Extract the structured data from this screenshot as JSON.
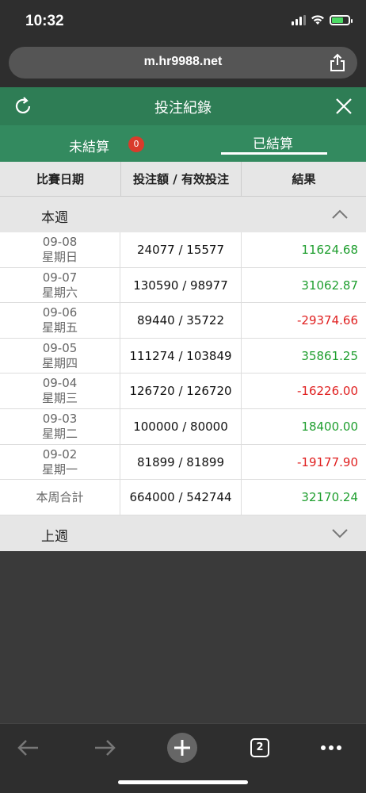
{
  "status_bar": {
    "time": "10:32"
  },
  "browser": {
    "url": "m.hr9988.net",
    "tab_count": "2"
  },
  "header": {
    "title": "投注紀錄"
  },
  "tabs": {
    "unsettled": {
      "label": "未結算",
      "badge": "0"
    },
    "settled": {
      "label": "已結算"
    }
  },
  "table": {
    "columns": [
      "比賽日期",
      "投注額 / 有效投注",
      "結果"
    ]
  },
  "this_week": {
    "title": "本週",
    "rows": [
      {
        "date": "09-08",
        "weekday": "星期日",
        "amount": "24077 / 15577",
        "result": "11624.68",
        "sign": "pos"
      },
      {
        "date": "09-07",
        "weekday": "星期六",
        "amount": "130590 / 98977",
        "result": "31062.87",
        "sign": "pos"
      },
      {
        "date": "09-06",
        "weekday": "星期五",
        "amount": "89440 / 35722",
        "result": "-29374.66",
        "sign": "neg"
      },
      {
        "date": "09-05",
        "weekday": "星期四",
        "amount": "111274 / 103849",
        "result": "35861.25",
        "sign": "pos"
      },
      {
        "date": "09-04",
        "weekday": "星期三",
        "amount": "126720 / 126720",
        "result": "-16226.00",
        "sign": "neg"
      },
      {
        "date": "09-03",
        "weekday": "星期二",
        "amount": "100000 / 80000",
        "result": "18400.00",
        "sign": "pos"
      },
      {
        "date": "09-02",
        "weekday": "星期一",
        "amount": "81899 / 81899",
        "result": "-19177.90",
        "sign": "neg"
      }
    ],
    "total": {
      "label": "本周合計",
      "amount": "664000 / 542744",
      "result": "32170.24"
    }
  },
  "last_week": {
    "title": "上週"
  },
  "colors": {
    "header_green": "#2e7d55",
    "tab_green": "#338a5f",
    "positive": "#1e9e2e",
    "negative": "#e02020"
  }
}
